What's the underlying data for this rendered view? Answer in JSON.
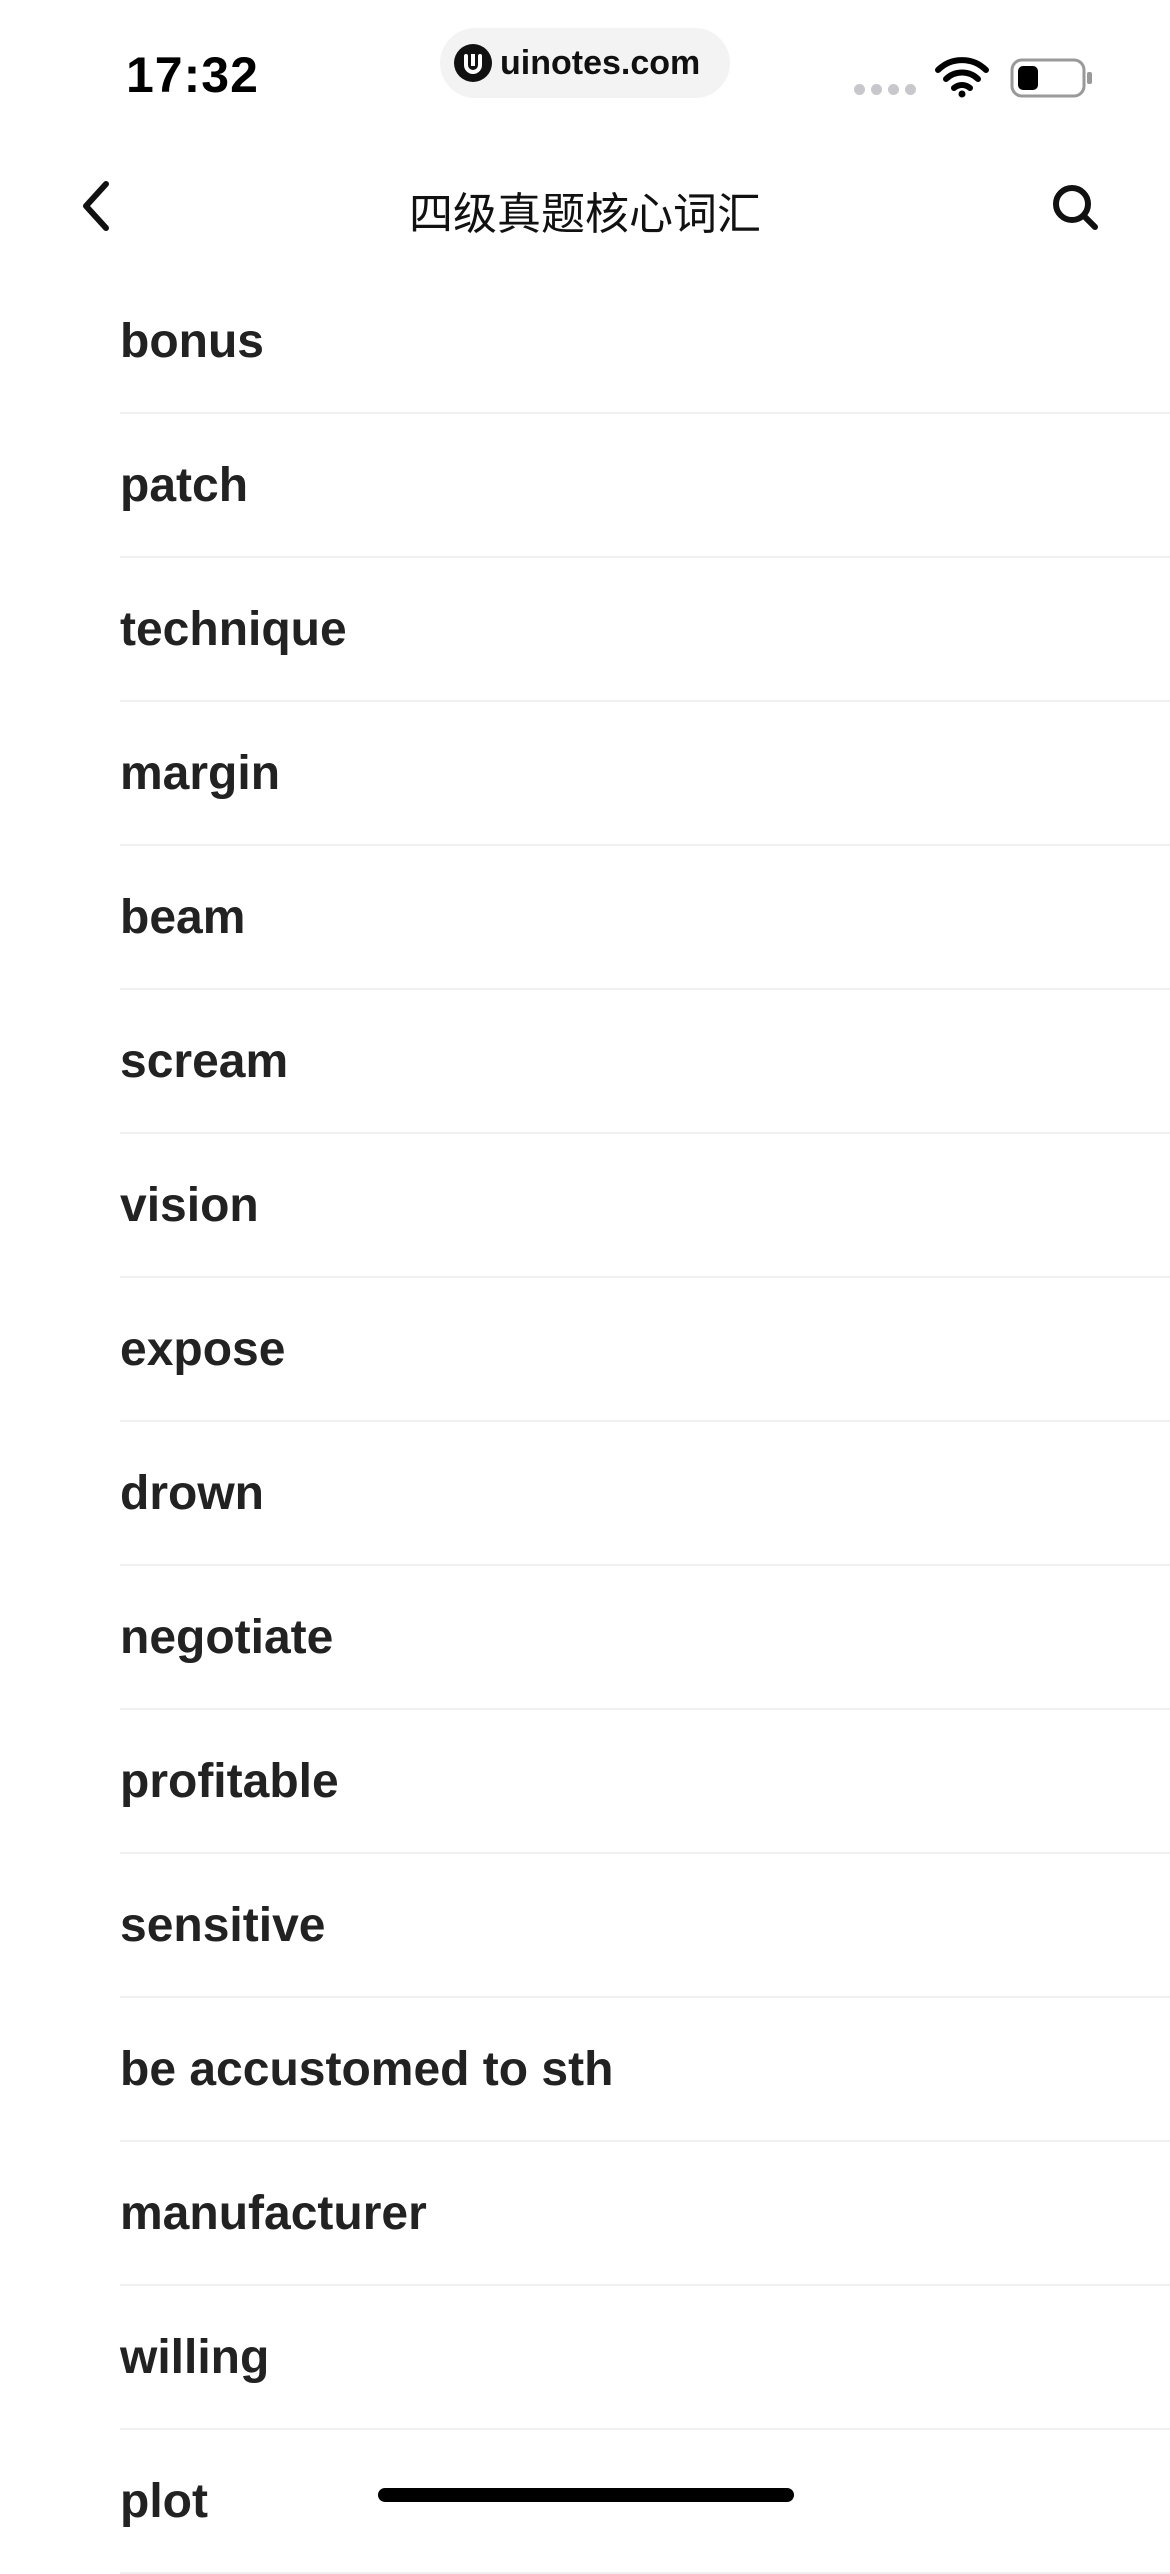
{
  "status_bar": {
    "time": "17:32",
    "url": "uinotes.com",
    "url_logo": "U"
  },
  "nav": {
    "title": "四级真题核心词汇",
    "back_icon": "chevron-left-icon",
    "search_icon": "search-icon"
  },
  "words": [
    "bonus",
    "patch",
    "technique",
    "margin",
    "beam",
    "scream",
    "vision",
    "expose",
    "drown",
    "negotiate",
    "profitable",
    "sensitive",
    "be accustomed to sth",
    "manufacturer",
    "willing",
    "plot"
  ],
  "colors": {
    "divider": "#f0f0f2",
    "text": "#222222",
    "background": "#ffffff"
  }
}
